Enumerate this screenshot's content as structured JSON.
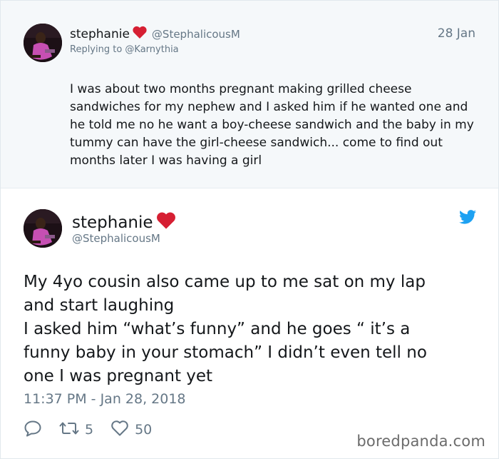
{
  "parent_tweet": {
    "display_name": "stephanie",
    "name_emoji": "red-heart",
    "handle": "@StephalicousM",
    "date": "28 Jan",
    "replying_to": "Replying to @Karnythia",
    "text": "I was about two months pregnant making grilled cheese sandwiches for my nephew and I asked him if he wanted one and he told me no he want a boy-cheese sandwich and the baby in my tummy can have the girl-cheese sandwich... come to find out months later I was having a girl"
  },
  "main_tweet": {
    "display_name": "stephanie",
    "name_emoji": "red-heart",
    "handle": "@StephalicousM",
    "text_lines": [
      "My 4yo cousin also came up to me sat on my lap",
      "and start laughing",
      "I asked him “what’s funny” and he goes “ it’s a",
      "funny baby in your stomach” I didn’t even tell no",
      "one I was pregnant yet"
    ],
    "timestamp": "11:37 PM - Jan 28, 2018",
    "reply_icon": "reply-icon",
    "retweet_icon": "retweet-icon",
    "retweet_count": "5",
    "like_icon": "like-icon",
    "like_count": "50"
  },
  "watermark": "boredpanda.com",
  "colors": {
    "twitter_blue": "#1da1f2",
    "heart_red": "#d61f33",
    "muted_text": "#657786",
    "parent_bg": "#f5f8fa"
  }
}
